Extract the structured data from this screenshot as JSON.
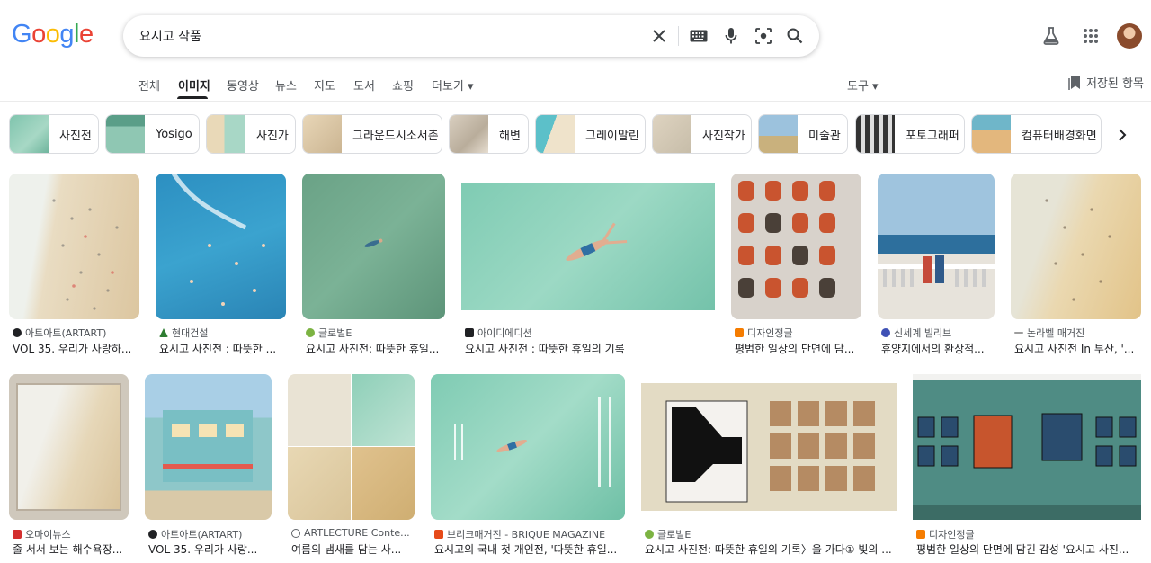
{
  "logo": {
    "text": "Google"
  },
  "search": {
    "query": "요시고 작품"
  },
  "tabs": [
    {
      "label": "전체",
      "active": false
    },
    {
      "label": "이미지",
      "active": true
    },
    {
      "label": "동영상",
      "active": false
    },
    {
      "label": "뉴스",
      "active": false
    },
    {
      "label": "지도",
      "active": false
    },
    {
      "label": "도서",
      "active": false
    },
    {
      "label": "쇼핑",
      "active": false
    },
    {
      "label": "더보기 ▾",
      "active": false
    }
  ],
  "tools": {
    "label": "도구 ▾"
  },
  "saved": {
    "label": "저장된 항목"
  },
  "chips": [
    "사진전",
    "Yosigo",
    "사진가",
    "그라운드시소서촌",
    "해변",
    "그레이말린",
    "사진작가",
    "미술관",
    "포토그래퍼",
    "컴퓨터배경화면"
  ],
  "results": [
    {
      "source": "아트아트(ARTART)",
      "title": "VOL 35. 우리가 사랑하...",
      "fav_color": "#202124"
    },
    {
      "source": "현대건설",
      "title": "요시고 사진전 : 따뜻한 ...",
      "fav_color": "#2e7d32"
    },
    {
      "source": "글로벌E",
      "title": "요시고 사진전: 따뜻한 휴일...",
      "fav_color": "#7cb342"
    },
    {
      "source": "아이디에디션",
      "title": "요시고 사진전 : 따뜻한 휴일의 기록",
      "fav_color": "#202124"
    },
    {
      "source": "디자인정글",
      "title": "평범한 일상의 단면에 담...",
      "fav_color": "#f57c00"
    },
    {
      "source": "신세계 빌리브",
      "title": "휴양지에서의 환상적...",
      "fav_color": "#3f51b5"
    },
    {
      "source": "논라벨 매거진",
      "title": "요시고 사진전 In 부산, '...",
      "fav_color": "#9e9e9e"
    },
    {
      "source": "오마이뉴스",
      "title": "줄 서서 보는 해수욕장...",
      "fav_color": "#d32f2f"
    },
    {
      "source": "아트아트(ARTART)",
      "title": "VOL 35. 우리가 사랑...",
      "fav_color": "#202124"
    },
    {
      "source": "ARTLECTURE Conte...",
      "title": "여름의 냄새를 담는 사...",
      "fav_color": "#5f6368"
    },
    {
      "source": "브리크매거진 - BRIQUE MAGAZINE",
      "title": "요시고의 국내 첫 개인전, '따뜻한 휴일...",
      "fav_color": "#e64a19"
    },
    {
      "source": "글로벌E",
      "title": "요시고 사진전: 따뜻한 휴일의 기록〉을 가다① 빛의 ...",
      "fav_color": "#7cb342"
    },
    {
      "source": "디자인정글",
      "title": "평범한 일상의 단면에 담긴 감성 '요시고 사진...",
      "fav_color": "#f57c00"
    }
  ]
}
